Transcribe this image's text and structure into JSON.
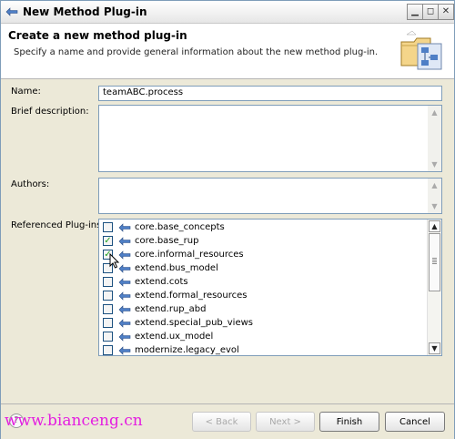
{
  "window": {
    "title": "New Method Plug-in",
    "controls": [
      "minimize",
      "maximize",
      "close"
    ]
  },
  "header": {
    "title": "Create a new method plug-in",
    "description": "Specify a name and provide general information about the new method plug-in."
  },
  "form": {
    "name_label": "Name:",
    "name_value": "teamABC.process",
    "brief_description_label": "Brief description:",
    "brief_description_value": "",
    "authors_label": "Authors:",
    "authors_value": "",
    "referenced_label": "Referenced Plug-ins:"
  },
  "plugins": [
    {
      "name": "core.base_concepts",
      "checked": false
    },
    {
      "name": "core.base_rup",
      "checked": true
    },
    {
      "name": "core.informal_resources",
      "checked": true
    },
    {
      "name": "extend.bus_model",
      "checked": false
    },
    {
      "name": "extend.cots",
      "checked": false
    },
    {
      "name": "extend.formal_resources",
      "checked": false
    },
    {
      "name": "extend.rup_abd",
      "checked": false
    },
    {
      "name": "extend.special_pub_views",
      "checked": false
    },
    {
      "name": "extend.ux_model",
      "checked": false
    },
    {
      "name": "modernize.legacy_evol",
      "checked": false
    }
  ],
  "footer": {
    "help_icon": "?",
    "back_label": "< Back",
    "next_label": "Next >",
    "finish_label": "Finish",
    "cancel_label": "Cancel"
  },
  "watermark": "www.bianceng.cn",
  "colors": {
    "watermark": "#e41ee0",
    "check": "#21a121",
    "plugin_icon": "#4f7fc6"
  }
}
